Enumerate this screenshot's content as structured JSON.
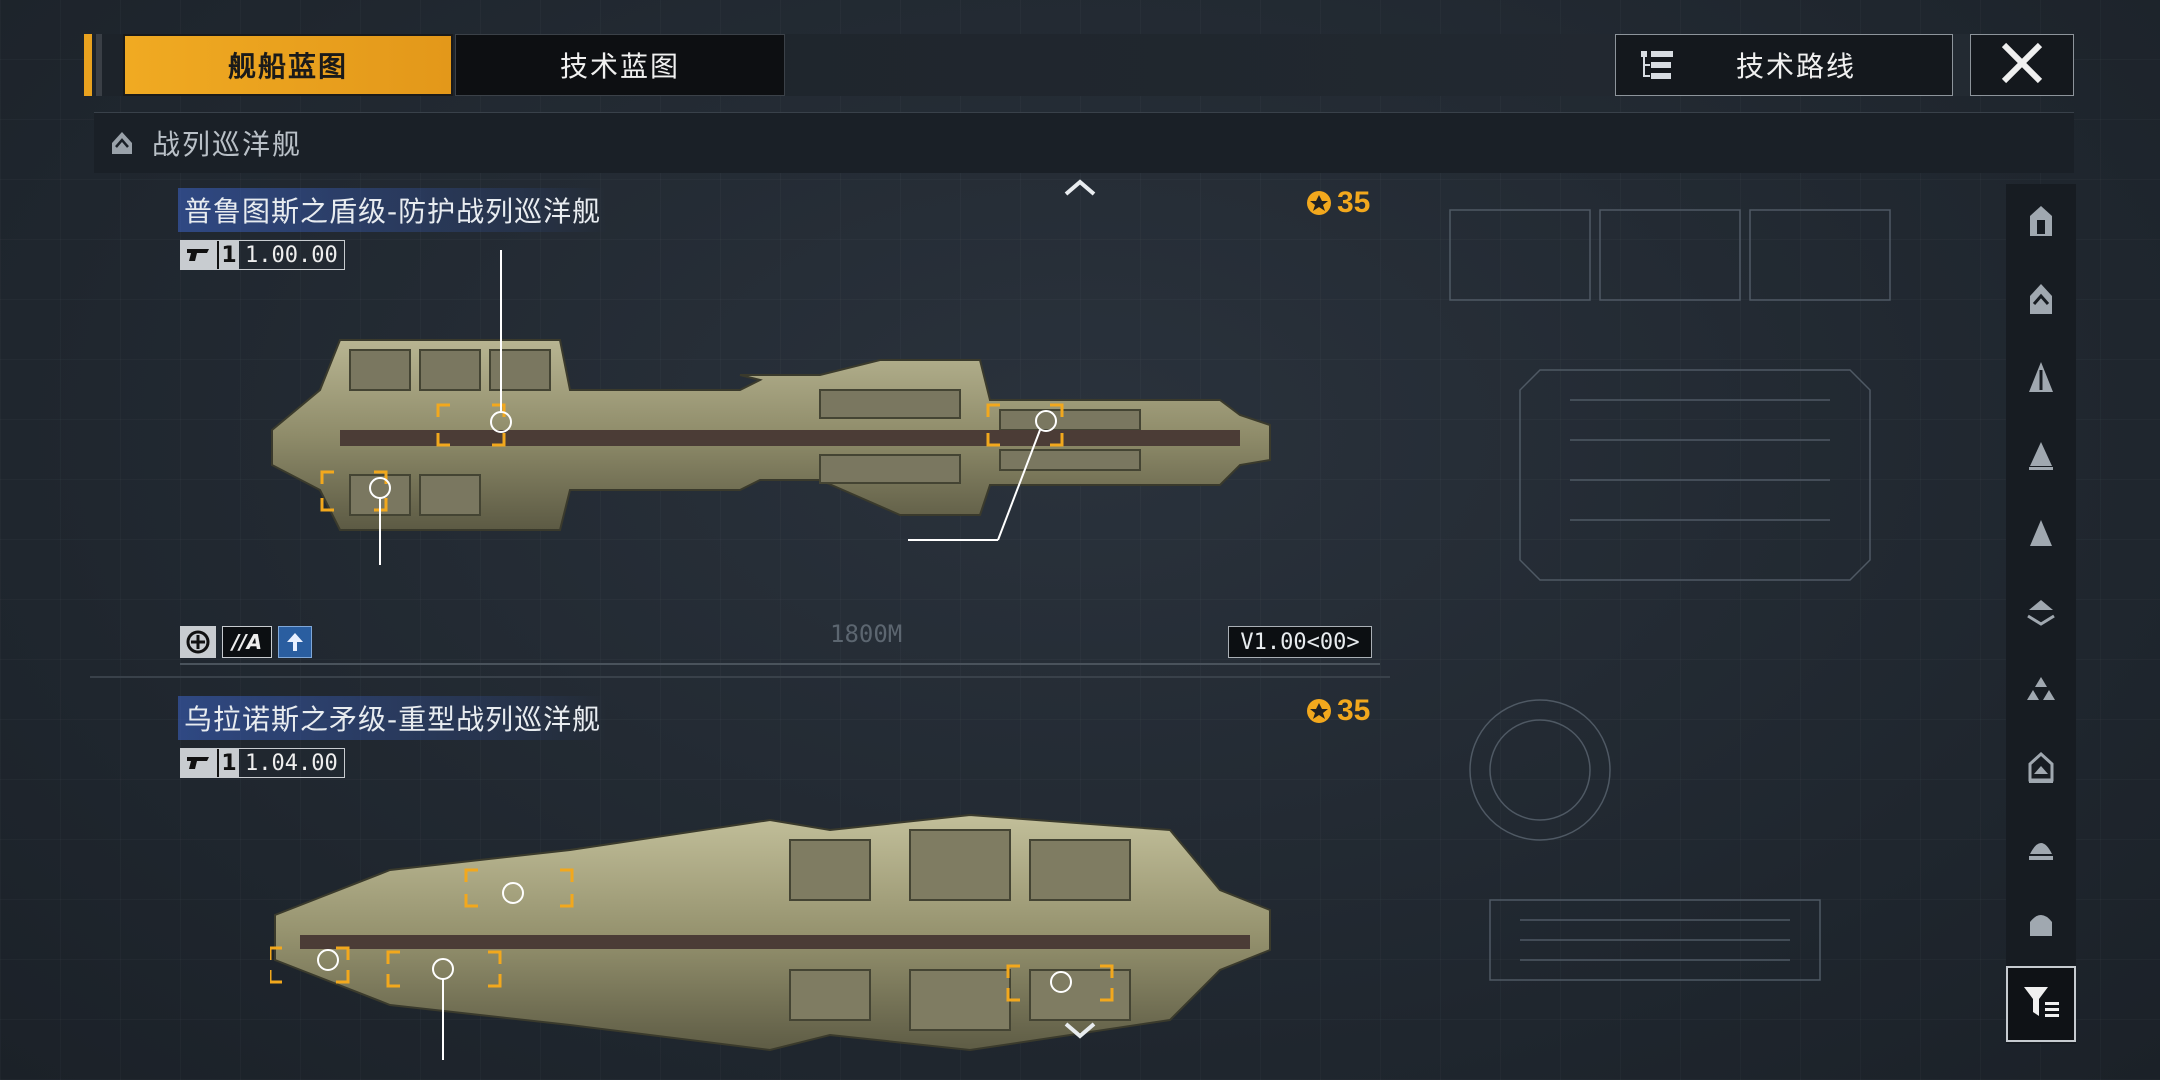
{
  "tabs": [
    {
      "label": "舰船蓝图",
      "active": true
    },
    {
      "label": "技术蓝图",
      "active": false
    }
  ],
  "roadmap_button": {
    "label": "技术路线",
    "icon": "tree-list-icon"
  },
  "close_button": {
    "icon": "close-icon"
  },
  "category": {
    "icon": "battlecruiser-icon",
    "label": "战列巡洋舰"
  },
  "ships": [
    {
      "name": "普鲁图斯之盾级-防护战列巡洋舰",
      "version_major": "1",
      "version": "1.00.00",
      "cost": "35",
      "variant_badge": "//A",
      "model_version": "V1.00<00>",
      "length_label": "1800M"
    },
    {
      "name": "乌拉诺斯之矛级-重型战列巡洋舰",
      "version_major": "1",
      "version": "1.04.00",
      "cost": "35"
    }
  ],
  "sidebar": {
    "items": [
      {
        "icon": "frigate-icon"
      },
      {
        "icon": "destroyer-icon"
      },
      {
        "icon": "cruiser-icon"
      },
      {
        "icon": "battlecruiser-icon"
      },
      {
        "icon": "auxiliary-ship-icon"
      },
      {
        "icon": "carrier-icon"
      },
      {
        "icon": "fighter-group-icon"
      },
      {
        "icon": "corvette-icon"
      },
      {
        "icon": "battleship-icon"
      },
      {
        "icon": "flagship-icon"
      }
    ],
    "filter_icon": "filter-icon"
  },
  "colors": {
    "accent": "#f0aa22",
    "background": "#222a33",
    "title_highlight": "#3c64c8"
  }
}
